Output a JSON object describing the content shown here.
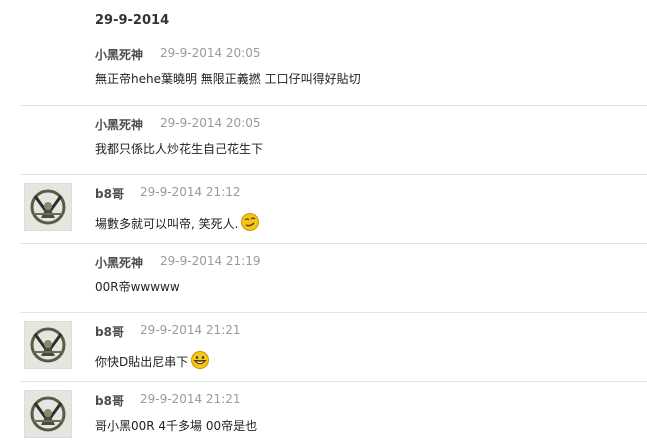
{
  "date_header": "29-9-2014",
  "posts": [
    {
      "user": "小黑死神",
      "time": "29-9-2014 20:05",
      "text": "無正帝hehe葉曉明 無限正義撚 工口仔叫得好貼切",
      "emoji": ""
    },
    {
      "user": "小黑死神",
      "time": "29-9-2014 20:05",
      "text": "我都只係比人炒花生自己花生下",
      "emoji": ""
    },
    {
      "user": "b8哥",
      "time": "29-9-2014 21:12",
      "text": "場數多就可以叫帝, 笑死人.",
      "emoji": "smirk-emoji"
    },
    {
      "user": "小黑死神",
      "time": "29-9-2014 21:19",
      "text": "00R帝wwwww",
      "emoji": ""
    },
    {
      "user": "b8哥",
      "time": "29-9-2014 21:21",
      "text": "你快D貼出尼串下",
      "emoji": "grin-emoji"
    },
    {
      "user": "b8哥",
      "time": "29-9-2014 21:21",
      "text": "哥小黑00R 4千多場 00帝是也",
      "emoji": ""
    }
  ],
  "colors": {
    "separator": "#e3e3e3",
    "name": "#4c4c4c",
    "time": "#9a9a9a",
    "emoji_yellow": "#f5c518"
  }
}
